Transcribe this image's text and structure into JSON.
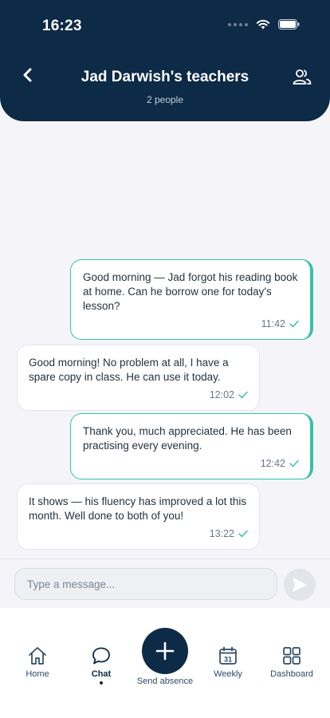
{
  "status_bar": {
    "time": "16:23"
  },
  "header": {
    "title": "Jad Darwish's teachers",
    "subtitle": "2 people"
  },
  "messages": [
    {
      "direction": "outgoing",
      "text": "Good morning — Jad forgot his reading book at home. Can he borrow one for today's lesson?",
      "time": "11:42"
    },
    {
      "direction": "incoming",
      "text": "Good morning! No problem at all, I have a spare copy in class. He can use it today.",
      "time": "12:02"
    },
    {
      "direction": "outgoing",
      "text": "Thank you, much appreciated. He has been practising every evening.",
      "time": "12:42"
    },
    {
      "direction": "incoming",
      "text": "It shows — his fluency has improved a lot this month. Well done to both of you!",
      "time": "13:22"
    }
  ],
  "composer": {
    "placeholder": "Type a message..."
  },
  "nav": {
    "home": "Home",
    "chat": "Chat",
    "send_absence": "Send absence",
    "weekly": "Weekly",
    "weekly_day": "31",
    "dashboard": "Dashboard"
  },
  "colors": {
    "header": "#0d2a47",
    "accent": "#35c2a6",
    "background": "#f5f5f9"
  }
}
